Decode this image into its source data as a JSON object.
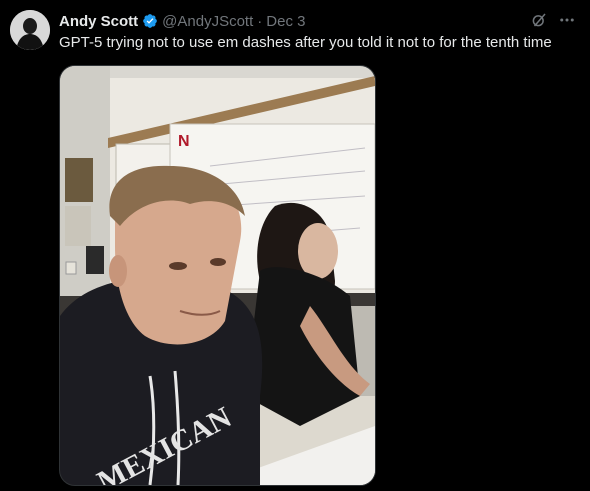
{
  "tweet": {
    "display_name": "Andy Scott",
    "handle": "@AndyJScott",
    "separator": "·",
    "date": "Dec 3",
    "text": "GPT-5 trying not to use em dashes after you told it not to for the tenth time",
    "verified": true,
    "icons": {
      "avatar": "profile-avatar",
      "verified": "verified-badge-icon",
      "grok": "grok-icon",
      "more": "more-icon"
    },
    "colors": {
      "background": "#000000",
      "primary_text": "#e7e9ea",
      "secondary_text": "#71767b",
      "verified": "#1d9bf0"
    }
  },
  "media": {
    "hoodie_text": "MEXICAN"
  }
}
